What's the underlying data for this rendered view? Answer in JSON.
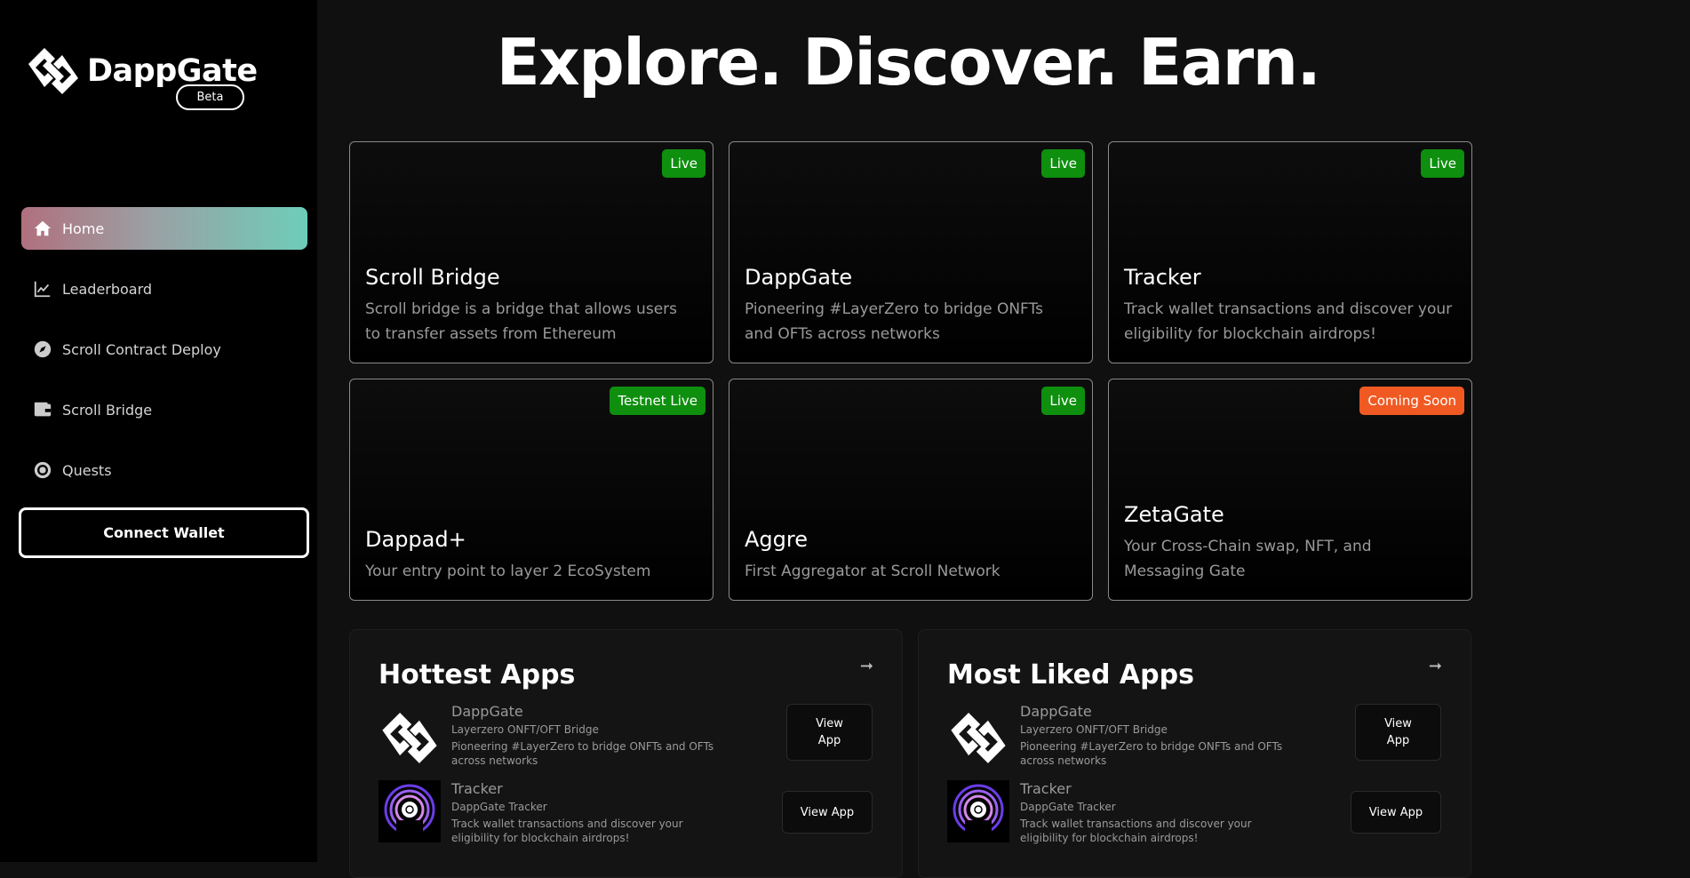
{
  "brand": {
    "name": "DappGate",
    "badge": "Beta"
  },
  "sidebar": {
    "items": [
      {
        "label": "Home",
        "icon": "home-icon",
        "active": true
      },
      {
        "label": "Leaderboard",
        "icon": "chart-icon",
        "active": false
      },
      {
        "label": "Scroll Contract Deploy",
        "icon": "compass-icon",
        "active": false
      },
      {
        "label": "Scroll Bridge",
        "icon": "wallet-icon",
        "active": false
      },
      {
        "label": "Quests",
        "icon": "target-icon",
        "active": false
      }
    ],
    "connect_label": "Connect Wallet"
  },
  "hero": {
    "title": "Explore. Discover. Earn."
  },
  "cards": [
    {
      "title": "Scroll Bridge",
      "desc": "Scroll bridge is a bridge that allows users to transfer assets from Ethereum",
      "badge": "Live",
      "badge_color": "#0e8f0e"
    },
    {
      "title": "DappGate",
      "desc": "Pioneering #LayerZero to bridge ONFTs and OFTs across networks",
      "badge": "Live",
      "badge_color": "#0e8f0e"
    },
    {
      "title": "Tracker",
      "desc": "Track wallet transactions and discover your eligibility for blockchain airdrops!",
      "badge": "Live",
      "badge_color": "#0e8f0e"
    },
    {
      "title": "Dappad+",
      "desc": "Your entry point to layer 2 EcoSystem",
      "badge": "Testnet Live",
      "badge_color": "#0e8f0e"
    },
    {
      "title": "Aggre",
      "desc": "First Aggregator at Scroll Network",
      "badge": "Live",
      "badge_color": "#0e8f0e"
    },
    {
      "title": "ZetaGate",
      "desc": "Your Cross-Chain swap, NFT, and Messaging Gate",
      "badge": "Coming Soon",
      "badge_color": "#f05a22"
    }
  ],
  "panels": [
    {
      "title": "Hottest Apps",
      "apps": [
        {
          "name": "DappGate",
          "sub": "Layerzero ONFT/OFT Bridge",
          "desc": "Pioneering #LayerZero to bridge ONFTs and OFTs across networks",
          "button": "View App",
          "icon": "dappgate-logo-icon"
        },
        {
          "name": "Tracker",
          "sub": "DappGate Tracker",
          "desc": "Track wallet transactions and discover your eligibility for blockchain airdrops!",
          "button": "View App",
          "icon": "tracker-logo-icon"
        }
      ]
    },
    {
      "title": "Most Liked Apps",
      "apps": [
        {
          "name": "DappGate",
          "sub": "Layerzero ONFT/OFT Bridge",
          "desc": "Pioneering #LayerZero to bridge ONFTs and OFTs across networks",
          "button": "View App",
          "icon": "dappgate-logo-icon"
        },
        {
          "name": "Tracker",
          "sub": "DappGate Tracker",
          "desc": "Track wallet transactions and discover your eligibility for blockchain airdrops!",
          "button": "View App",
          "icon": "tracker-logo-icon"
        }
      ]
    }
  ]
}
